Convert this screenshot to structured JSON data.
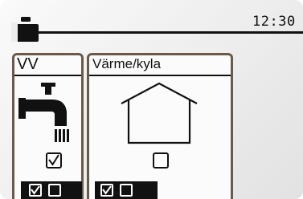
{
  "header": {
    "clock": "12:30",
    "icon": "suitcase-icon"
  },
  "panels": [
    {
      "title": "VV",
      "icon": "faucet-icon",
      "checked": true,
      "bar": [
        true,
        false
      ],
      "selected": true
    },
    {
      "title": "Värme/kyla",
      "icon": "house-icon",
      "checked": false,
      "bar": [
        true,
        false
      ],
      "selected": false
    }
  ],
  "colors": {
    "panel_border": "#6a5a4a",
    "ink": "#111111",
    "background": "#f0f0f0"
  }
}
